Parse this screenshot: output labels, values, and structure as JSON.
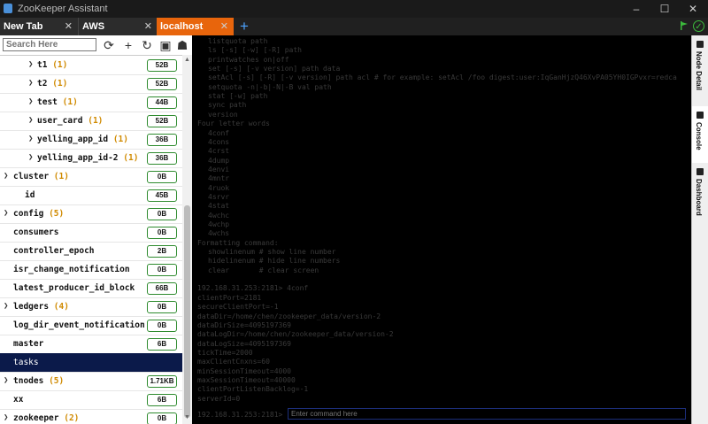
{
  "window": {
    "title": "ZooKeeper Assistant"
  },
  "tabs": [
    {
      "label": "New Tab"
    },
    {
      "label": "AWS"
    },
    {
      "label": "localhost"
    }
  ],
  "sidebar": {
    "search_placeholder": "Search Here",
    "rows": [
      {
        "label": "t1",
        "count": "(1)",
        "size": "52B"
      },
      {
        "label": "t2",
        "count": "(1)",
        "size": "52B"
      },
      {
        "label": "test",
        "count": "(1)",
        "size": "44B"
      },
      {
        "label": "user_card",
        "count": "(1)",
        "size": "52B"
      },
      {
        "label": "yelling_app_id",
        "count": "(1)",
        "size": "36B"
      },
      {
        "label": "yelling_app_id-2",
        "count": "(1)",
        "size": "36B"
      },
      {
        "label": "cluster",
        "count": "(1)",
        "size": "0B"
      },
      {
        "label": "id",
        "count": "",
        "size": "45B"
      },
      {
        "label": "config",
        "count": "(5)",
        "size": "0B"
      },
      {
        "label": "consumers",
        "count": "",
        "size": "0B"
      },
      {
        "label": "controller_epoch",
        "count": "",
        "size": "2B"
      },
      {
        "label": "isr_change_notification",
        "count": "",
        "size": "0B"
      },
      {
        "label": "latest_producer_id_block",
        "count": "",
        "size": "66B"
      },
      {
        "label": "ledgers",
        "count": "(4)",
        "size": "0B"
      },
      {
        "label": "log_dir_event_notification",
        "count": "",
        "size": "0B"
      },
      {
        "label": "master",
        "count": "",
        "size": "6B"
      },
      {
        "label": "tasks",
        "count": "",
        "size": ""
      },
      {
        "label": "tnodes",
        "count": "(5)",
        "size": "1.71KB"
      },
      {
        "label": "xx",
        "count": "",
        "size": "6B"
      },
      {
        "label": "zookeeper",
        "count": "(2)",
        "size": "0B"
      }
    ]
  },
  "console": {
    "lines": [
      "      listquota path",
      "      ls [-s] [-w] [-R] path",
      "      printwatches on|off",
      "      set [-s] [-v version] path data",
      "      setAcl [-s] [-R] [-v version] path acl # for example: setAcl /foo digest:user:IqGanHjzQ46XvPA05YH0IGPvxr=redca",
      "      setquota -n|-b|-N|-B val path",
      "      stat [-w] path",
      "      sync path",
      "      version",
      "Four letter words",
      "      4conf",
      "      4cons",
      "      4crst",
      "      4dump",
      "      4envi",
      "      4mntr",
      "      4ruok",
      "      4srvr",
      "      4stat",
      "      4wchc",
      "      4wchp",
      "      4wchs",
      "Formatting command:",
      "      showlinenum # show line number",
      "      hidelinenum # hide line numbers",
      "      clear       # clear screen",
      "",
      "192.168.31.253:2181> 4conf",
      "clientPort=2181",
      "secureClientPort=-1",
      "dataDir=/home/chen/zookeeper_data/version-2",
      "dataDirSize=4095197369",
      "dataLogDir=/home/chen/zookeeper_data/version-2",
      "dataLogSize=4095197369",
      "tickTime=2000",
      "maxClientCnxns=60",
      "minSessionTimeout=4000",
      "maxSessionTimeout=40000",
      "clientPortListenBacklog=-1",
      "serverId=0"
    ],
    "prompt": "192.168.31.253:2181>",
    "input_placeholder": "Enter command here"
  },
  "right_panel": {
    "tabs": [
      {
        "label": "Node Detail"
      },
      {
        "label": "Console"
      },
      {
        "label": "Dashboard"
      }
    ]
  },
  "colors": {
    "active_tab": "#e8650c",
    "size_border": "#2e8b2e",
    "count_text": "#d08a00",
    "selected_row": "#0b1a4a"
  }
}
